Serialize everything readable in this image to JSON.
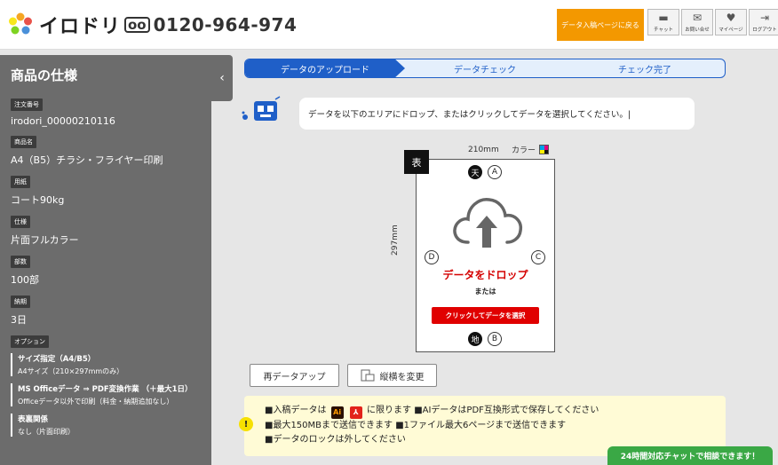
{
  "header": {
    "logo_text": "イロドリ",
    "tel_icon": "📞",
    "tel_number": "0120-964-974",
    "back_button": "データ入稿ページに戻る",
    "icons": [
      {
        "name": "chat-icon",
        "glyph": "💬",
        "label": "チャット"
      },
      {
        "name": "mail-icon",
        "glyph": "✉",
        "label": "お問い合せ"
      },
      {
        "name": "heart-icon",
        "glyph": "♥",
        "label": "マイページ"
      },
      {
        "name": "logout-icon",
        "glyph": "⇥",
        "label": "ログアウト"
      }
    ]
  },
  "sidebar": {
    "title": "商品の仕様",
    "fields": [
      {
        "tag": "注文番号",
        "value": "irodori_00000210116"
      },
      {
        "tag": "商品名",
        "value": "A4（B5）チラシ・フライヤー印刷"
      },
      {
        "tag": "用紙",
        "value": "コート90kg"
      },
      {
        "tag": "仕様",
        "value": "片面フルカラー"
      },
      {
        "tag": "部数",
        "value": "100部"
      },
      {
        "tag": "納期",
        "value": "3日"
      }
    ],
    "option_tag": "オプション",
    "options": [
      {
        "title": "サイズ指定（A4/B5）",
        "value": "A4サイズ（210×297mmのみ）"
      },
      {
        "title": "MS Officeデータ ⇒ PDF変換作業 （＋最大1日）",
        "value": "Officeデータ以外で印刷（料金・納期追加なし）"
      },
      {
        "title": "表裏関係",
        "value": "なし（片面印刷）"
      }
    ],
    "collapse_icon": "‹"
  },
  "steps": [
    {
      "label": "データのアップロード",
      "active": true
    },
    {
      "label": "データチェック",
      "active": false
    },
    {
      "label": "チェック完了",
      "active": false
    }
  ],
  "message": "データを以下のエリアにドロップ、またはクリックしてデータを選択してください。|",
  "preview": {
    "width_label": "210mm",
    "height_label": "297mm",
    "color_label": "カラー",
    "side_label": "表",
    "top_label": "天",
    "bottom_label": "地",
    "marks": {
      "a": "A",
      "b": "B",
      "c": "C",
      "d": "D"
    },
    "drop_text": "データをドロップ",
    "or_text": "または",
    "select_button": "クリックしてデータを選択"
  },
  "actions": {
    "reupload": "再データアップ",
    "rotate": "縦横を変更"
  },
  "notice": {
    "line1_a": "■入稿データは",
    "ai_badge": "Ai",
    "pdf_badge": "⅄",
    "line1_b": "に限ります ■AIデータはPDF互換形式で保存してください",
    "line2": "■最大150MBまで送信できます ■1ファイル最大6ページまで送信できます",
    "line3": "■データのロックは外してください",
    "warn_icon": "!"
  },
  "chat_bar": "24時間対応チャットで相談できます！",
  "colors": {
    "accent": "#1f5fc8",
    "orange": "#f39800",
    "red": "#e00000",
    "green": "#3aa845",
    "sidebar": "#6c6c6c"
  }
}
